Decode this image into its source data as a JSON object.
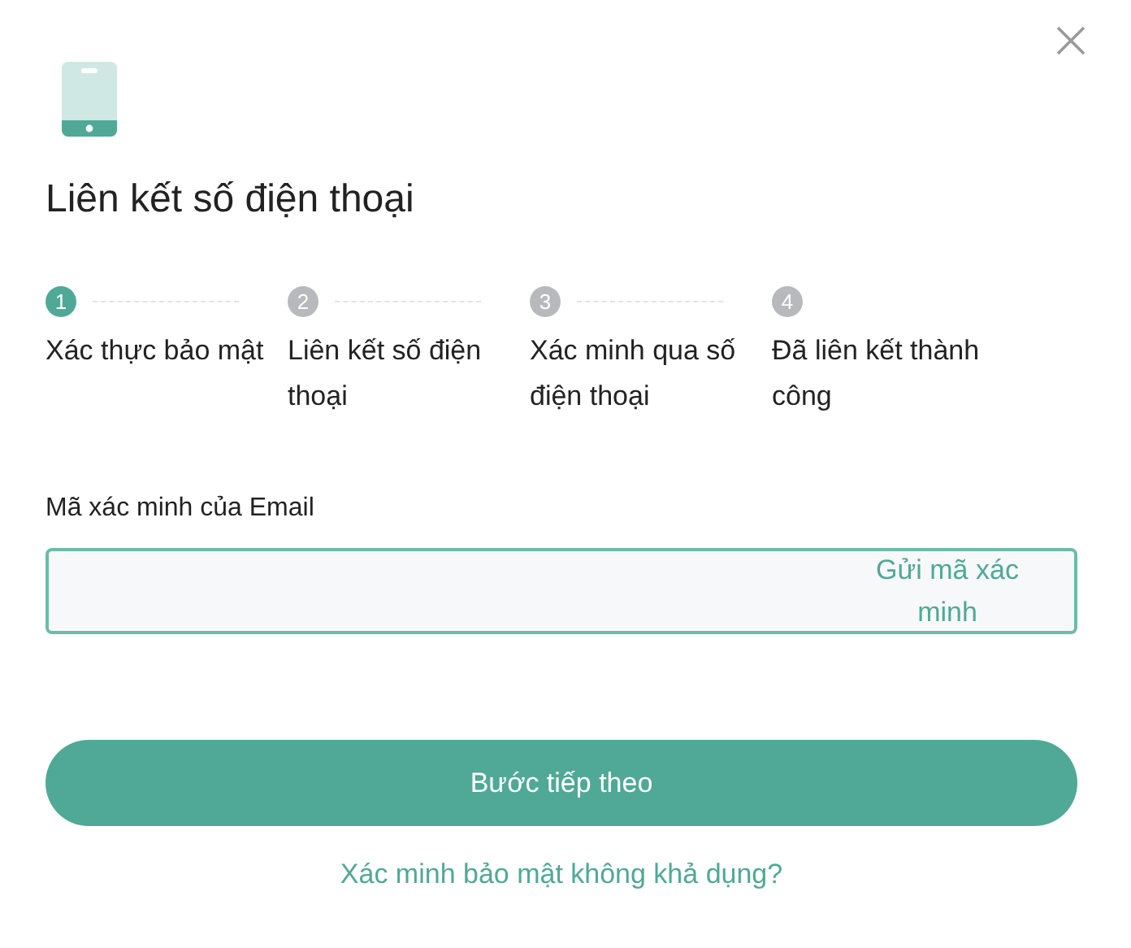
{
  "title": "Liên kết số điện thoại",
  "steps": [
    {
      "number": "1",
      "label": "Xác thực bảo mật",
      "selected": true
    },
    {
      "number": "2",
      "label": "Liên kết số điện thoại",
      "selected": false
    },
    {
      "number": "3",
      "label": "Xác minh qua số điện thoại",
      "selected": false
    },
    {
      "number": "4",
      "label": "Đã liên kết thành công",
      "selected": false
    }
  ],
  "code_field": {
    "label": "Mã xác minh của Email",
    "send_button": "Gửi mã xác minh"
  },
  "next_button": "Bước tiếp theo",
  "help_link": "Xác minh bảo mật không khả dụng?"
}
